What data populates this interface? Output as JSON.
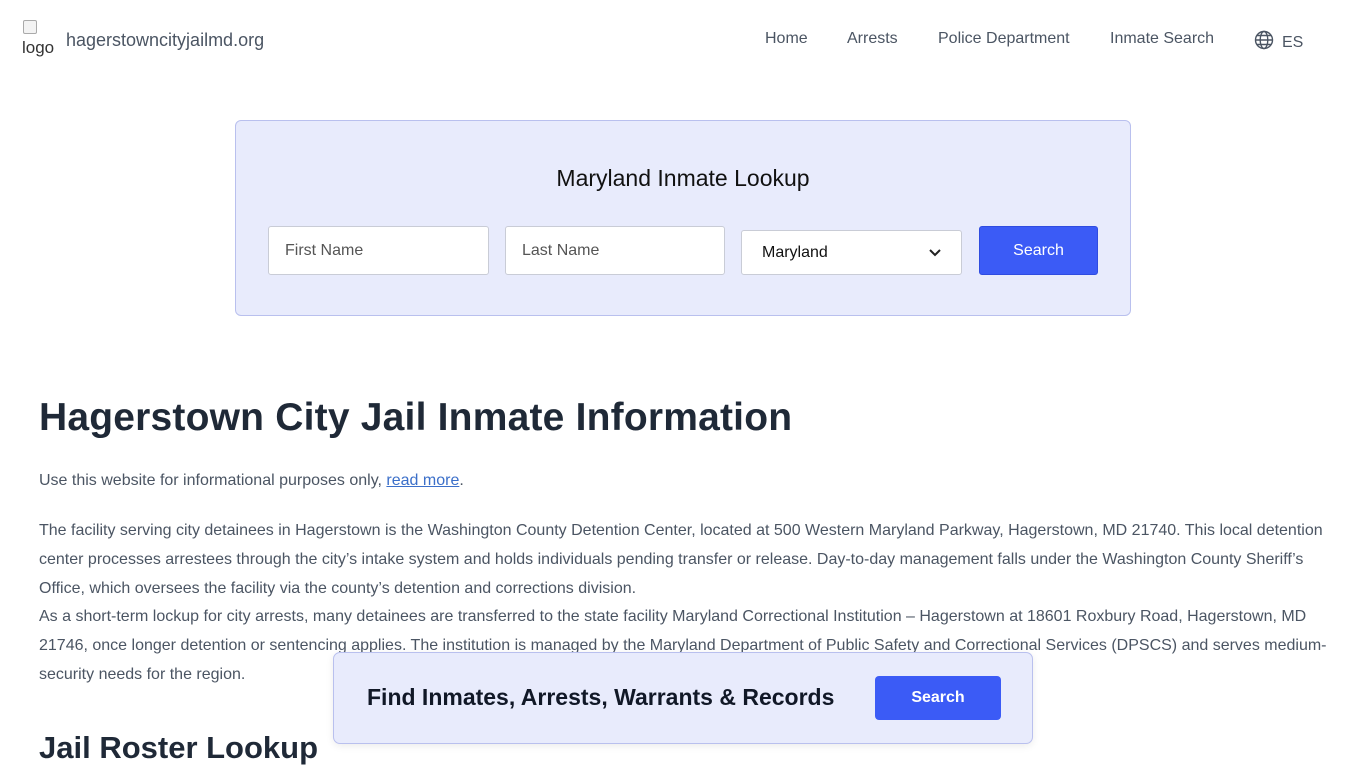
{
  "header": {
    "logo_alt": "logo",
    "site_name": "hagerstowncityjailmd.org",
    "nav": {
      "home": "Home",
      "arrests": "Arrests",
      "police": "Police Department",
      "inmate_search": "Inmate Search"
    },
    "language": "ES",
    "language_icon": "globe-icon"
  },
  "search": {
    "title": "Maryland Inmate Lookup",
    "first_name_placeholder": "First Name",
    "last_name_placeholder": "Last Name",
    "state_selected": "Maryland",
    "button": "Search"
  },
  "main": {
    "title": "Hagerstown City Jail Inmate Information",
    "disclaimer_text": "Use this website for informational purposes only, ",
    "disclaimer_link": "read more",
    "disclaimer_end": ".",
    "paragraph1": "The facility serving city detainees in Hagerstown is the Washington County Detention Center, located at 500 Western Maryland Parkway, Hagerstown, MD 21740. This local detention center processes arrestees through the city’s intake system and holds individuals pending transfer or release. Day-to-day management falls under the Washington County Sheriff’s Office, which oversees the facility via the county’s detention and corrections division.",
    "paragraph2": "As a short-term lockup for city arrests, many detainees are transferred to the state facility Maryland Correctional Institution – Hagerstown at 18601 Roxbury Road, Hagerstown, MD 21746, once longer detention or sentencing applies. The institution is managed by the Maryland Department of Public Safety and Correctional Services (DPSCS) and serves medium-security needs for the region.",
    "section_title": "Jail Roster Lookup"
  },
  "cta": {
    "text": "Find Inmates, Arrests, Warrants & Records",
    "button": "Search"
  },
  "colors": {
    "accent": "#3b5bf6",
    "panel": "#e8ebfc",
    "link": "#3b6fc9"
  }
}
